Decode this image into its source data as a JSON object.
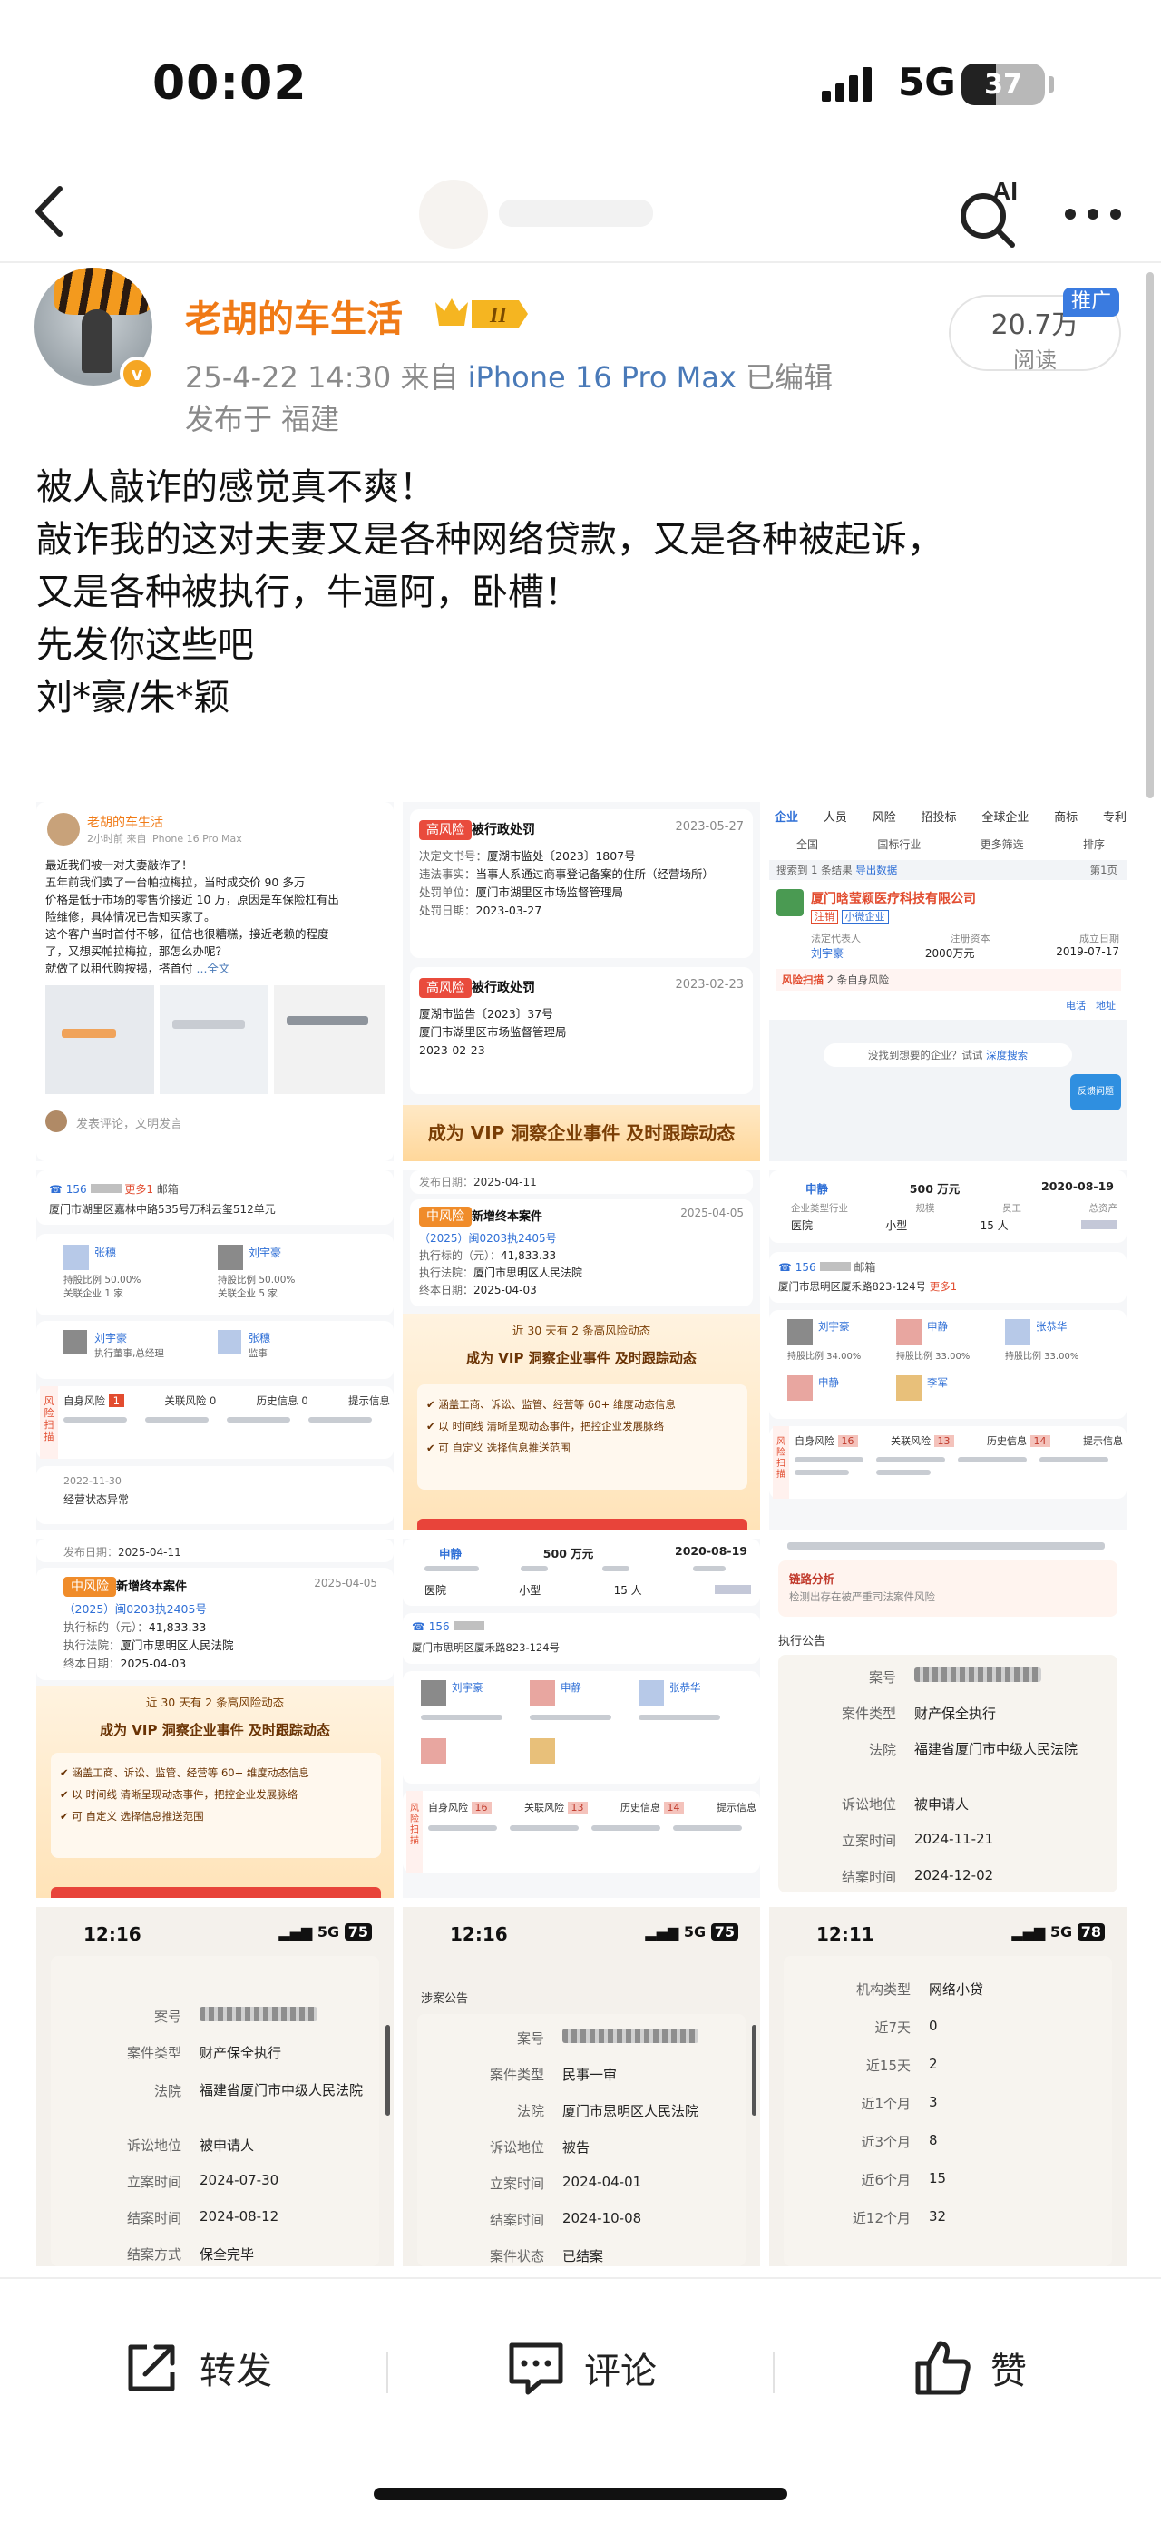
{
  "status_bar": {
    "time": "00:02",
    "network": "5G",
    "battery": "37"
  },
  "author": {
    "name": "老胡的车生活",
    "level": "II",
    "date": "25-4-22 14:30",
    "source_prefix": "来自",
    "device": "iPhone 16 Pro Max",
    "edited": "已编辑",
    "location": "发布于 福建",
    "reads": "20.7万",
    "reads_label": "阅读",
    "promo_tag": "推广"
  },
  "post": {
    "lines": [
      "被人敲诈的感觉真不爽！",
      "敲诈我的这对夫妻又是各种网络贷款，又是各种被起诉，",
      "又是各种被执行，牛逼阿，卧槽！",
      "先发你这些吧",
      "刘*豪/朱*颖"
    ]
  },
  "images": {
    "img1": {
      "name": "老胡的车生活",
      "meta": "2小时前 来自 iPhone 16 Pro Max",
      "text1": "最近我们被一对夫妻敲诈了！",
      "text2": "五年前我们卖了一台帕拉梅拉，当时成交价 90 多万",
      "text3": "价格是低于市场的零售价接近 10 万，原因是车保险杠有出",
      "text4": "险维修，具体情况已告知买家了。",
      "text5": "这个客户当时首付不够，征信也很糟糕，接近老赖的程度",
      "text6": "了，又想买帕拉梅拉，那怎么办呢？",
      "text7": "就做了以租代购按揭，搭首付",
      "full": "...全文",
      "comment": "发表评论，文明发言"
    },
    "img2": {
      "tag1": "高风险",
      "title1": "被行政处罚",
      "date1": "2023-05-27",
      "doc1_label": "决定文书号：",
      "doc1": "厦湖市监处〔2023〕1807号",
      "fact1_label": "违法事实：",
      "fact1": "当事人系通过商事登记备案的住所（经营场所）",
      "org1_label": "处罚单位：",
      "org1": "厦门市湖里区市场监督管理局",
      "pdate1_label": "处罚日期：",
      "pdate1": "2023-03-27",
      "tag2": "高风险",
      "title2": "被行政处罚",
      "date2": "2023-02-23",
      "doc2": "厦湖市监告〔2023〕37号",
      "org2": "厦门市湖里区市场监督管理局",
      "pdate2": "2023-02-23",
      "banner": "成为 VIP 洞察企业事件 及时跟踪动态"
    },
    "img3": {
      "tabs": [
        "企业",
        "人员",
        "风险",
        "招投标",
        "全球企业",
        "商标",
        "专利"
      ],
      "filters": [
        "全国",
        "国标行业",
        "更多筛选",
        "排序"
      ],
      "result": "搜索到 1 条结果",
      "export": "导出数据",
      "page": "第1页",
      "company": "厦门晗莹颖医疗科技有限公司",
      "status": "注销",
      "scale": "小微企业",
      "rep_label": "法定代表人",
      "rep": "刘宇豪",
      "capital_label": "注册资本",
      "capital": "2000万元",
      "founded_label": "成立日期",
      "founded": "2019-07-17",
      "risk": "风险扫描",
      "risk_count": "2 条自身风险",
      "phone": "电话",
      "address": "地址",
      "hint": "没找到想要的企业？试试",
      "deep": "深度搜索",
      "feedback": "反馈问题"
    },
    "img4": {
      "phone_count": "156",
      "more": "更多1",
      "email": "邮箱",
      "address": "厦门市湖里区嘉林中路535号万科云玺512单元",
      "p1": "张穗",
      "p1_share": "持股比例 50.00%",
      "p1_rel": "关联企业 1 家",
      "p2": "刘宇豪",
      "p2_share": "持股比例 50.00%",
      "p2_rel": "关联企业 5 家",
      "p3": "刘宇豪",
      "p3_role": "执行董事,总经理",
      "p4": "张穗",
      "p4_role": "监事",
      "risk1": "自身风险",
      "risk1_n": "1",
      "risk2": "关联风险",
      "risk2_n": "0",
      "risk3": "历史信息",
      "risk3_n": "0",
      "risk4": "提示信息",
      "date": "2022-11-30",
      "event": "经营状态异常"
    },
    "img5": {
      "pub_label": "发布日期：",
      "pub": "2025-04-11",
      "tag": "中风险",
      "title": "新增终本案件",
      "date": "2025-04-05",
      "case": "（2025）闽0203执2405号",
      "amount_label": "执行标的（元）：",
      "amount": "41,833.33",
      "court_label": "执行法院：",
      "court": "厦门市思明区人民法院",
      "end_label": "终本日期：",
      "end": "2025-04-03",
      "count": "近 30 天有 2 条高风险动态",
      "banner": "成为 VIP 洞察企业事件 及时跟踪动态",
      "b1": "涵盖工商、诉讼、监管、经营等 60+ 维度动态信息",
      "b2": "以 时间线 清晰呈现动态事件，把控企业发展脉络",
      "b3": "可 自定义 选择信息推送范围"
    },
    "img6": {
      "status": "申静",
      "capital": "500 万元",
      "date": "2020-08-19",
      "industry_label": "企业类型行业",
      "industry": "医院",
      "scale_label": "规模",
      "scale": "小型",
      "staff_label": "员工",
      "staff": "15 人",
      "assets_label": "总资产",
      "phone_count": "156",
      "email": "邮箱",
      "address": "厦门市思明区厦禾路823-124号",
      "more": "更多1",
      "p1": "刘宇豪",
      "p1_share": "持股比例 34.00%",
      "p2": "申静",
      "p2_share": "持股比例 33.00%",
      "p3": "张恭华",
      "p3_share": "持股比例 33.00%",
      "p4": "申静",
      "p5": "李军",
      "risk1": "自身风险",
      "risk1_n": "16",
      "risk2": "关联风险",
      "risk2_n": "13",
      "risk3": "历史信息",
      "risk3_n": "14",
      "risk4": "提示信息"
    },
    "img7": {
      "pub": "2025-04-11",
      "tag": "中风险",
      "title": "新增终本案件",
      "date": "2025-04-05",
      "case": "（2025）闽0203执2405号",
      "amount": "41,833.33",
      "court": "厦门市思明区人民法院",
      "end": "2025-04-03",
      "count": "近 30 天有 2 条高风险动态",
      "banner": "成为 VIP 洞察企业事件 及时跟踪动态",
      "b1": "涵盖工商、诉讼、监管、经营等 60+ 维度动态信息",
      "b2": "以 时间线 清晰呈现动态事件，把控企业发展脉络",
      "b3": "可 自定义 选择信息推送范围"
    },
    "img8": {
      "status": "申静",
      "capital": "500 万元",
      "date": "2020-08-19",
      "industry": "医院",
      "scale": "小型",
      "staff": "15 人",
      "phone_count": "156",
      "address": "厦门市思明区厦禾路823-124号",
      "p1": "刘宇豪",
      "p2": "申静",
      "p3": "张恭华",
      "risk1_n": "16",
      "risk2_n": "13",
      "risk3_n": "14"
    },
    "img9": {
      "analysis": "链路分析",
      "analysis_desc": "检测出存在被严重司法案件风险",
      "section": "执行公告",
      "case_label": "案号",
      "type_label": "案件类型",
      "type": "财产保全执行",
      "court_label": "法院",
      "court": "福建省厦门市中级人民法院",
      "role_label": "诉讼地位",
      "role": "被申请人",
      "filed_label": "立案时间",
      "filed": "2024-11-21",
      "closed_label": "结案时间",
      "closed": "2024-12-02"
    },
    "img10": {
      "time": "12:16",
      "net": "5G",
      "batt": "75",
      "case_label": "案号",
      "type_label": "案件类型",
      "type": "财产保全执行",
      "court_label": "法院",
      "court": "福建省厦门市中级人民法院",
      "role_label": "诉讼地位",
      "role": "被申请人",
      "filed_label": "立案时间",
      "filed": "2024-07-30",
      "closed_label": "结案时间",
      "closed": "2024-08-12",
      "method_label": "结案方式",
      "method": "保全完毕"
    },
    "img11": {
      "time": "12:16",
      "net": "5G",
      "batt": "75",
      "section": "涉案公告",
      "case_label": "案号",
      "type_label": "案件类型",
      "type": "民事一审",
      "court_label": "法院",
      "court": "厦门市思明区人民法院",
      "role_label": "诉讼地位",
      "role": "被告",
      "filed_label": "立案时间",
      "filed": "2024-04-01",
      "closed_label": "结案时间",
      "closed": "2024-10-08",
      "status_label": "案件状态",
      "status": "已结案"
    },
    "img12": {
      "time": "12:11",
      "net": "5G",
      "batt": "78",
      "org_label": "机构类型",
      "org": "网络小贷",
      "r1_label": "近7天",
      "r1": "0",
      "r2_label": "近15天",
      "r2": "2",
      "r3_label": "近1个月",
      "r3": "3",
      "r4_label": "近3个月",
      "r4": "8",
      "r5_label": "近6个月",
      "r5": "15",
      "r6_label": "近12个月",
      "r6": "32"
    }
  },
  "actions": {
    "repost": "转发",
    "comment": "评论",
    "like": "赞"
  },
  "colors": {
    "author": "#f07a16",
    "device": "#4a7ab8",
    "promo": "#3a7be0",
    "link": "#2f6fd6"
  }
}
